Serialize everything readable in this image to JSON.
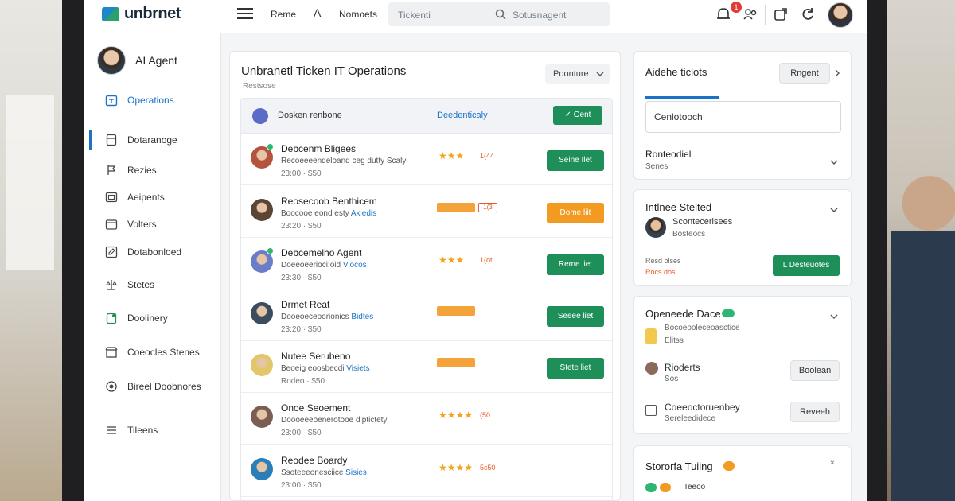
{
  "topbar": {
    "logo_text": "unbrnet",
    "nav_1": "Reme",
    "nav_2_icon": "A",
    "nav_3": "Nomoets",
    "search_placeholder": "Tickenti",
    "search_placeholder_2": "Sotusnagent",
    "notification_count": "1"
  },
  "sidebar": {
    "agent_name": "AI Agent",
    "items": [
      {
        "label": "Operations",
        "icon": "calendar-icon"
      },
      {
        "label": "Dotaranoge",
        "icon": "document-icon"
      },
      {
        "label": "Rezies",
        "icon": "flag-icon"
      },
      {
        "label": "Aeipents",
        "icon": "image-icon"
      },
      {
        "label": "Volters",
        "icon": "folder-icon"
      },
      {
        "label": "Dotabonloed",
        "icon": "edit-icon"
      },
      {
        "label": "Stetes",
        "icon": "scale-icon"
      },
      {
        "label": "Doolinery",
        "icon": "clipboard-icon"
      },
      {
        "label": "Coeocles Stenes",
        "icon": "store-icon"
      },
      {
        "label": "Bireel Doobnores",
        "icon": "circle-icon"
      },
      {
        "label": "Tileens",
        "icon": "list-icon"
      }
    ]
  },
  "main": {
    "title": "Unbranetl Ticken IT Operations",
    "subtitle": "Restsose",
    "dropdown_label": "Poonture",
    "header_row": {
      "name": "Dosken renbone",
      "link": "Deedenticaly",
      "button": "Oent"
    },
    "rows": [
      {
        "name": "Debcenm Bligees",
        "desc": "Recoeeeendeloand ceg dutty Scaly",
        "desc_link": "",
        "meta": "23:00  ·  $50",
        "stars": "★★★",
        "rating": "1(44",
        "button": "Seine Ilet",
        "style": "stars",
        "online": true,
        "avatar_color": "#b5543e"
      },
      {
        "name": "Reosecoob Benthicem",
        "desc": "Boocooe eond esty",
        "desc_link": "Akiedis",
        "meta": "23:20  ·  $50",
        "stars": "",
        "rating": "1(3",
        "button": "Dome liit",
        "style": "tag",
        "online": false,
        "avatar_color": "#5b4535"
      },
      {
        "name": "Debcemelho Agent",
        "desc": "Doeeoeerioci:oid",
        "desc_link": "Viocos",
        "meta": "23:30  ·  $50",
        "stars": "★★★",
        "rating": "1(ot",
        "button": "Reme liet",
        "style": "stars",
        "online": true,
        "avatar_color": "#6a7dc9"
      },
      {
        "name": "Drmet Reat",
        "desc": "Dooeoeceoorionics",
        "desc_link": "Bidtes",
        "meta": "23:20  ·  $50",
        "stars": "",
        "rating": "",
        "button": "Seeee liet",
        "style": "tag",
        "online": false,
        "avatar_color": "#3b4c5e"
      },
      {
        "name": "Nutee Serubeno",
        "desc": "Beoeig eoosbecdi",
        "desc_link": "Visiets",
        "meta": "Rodeo  ·  $50",
        "stars": "",
        "rating": "",
        "button": "Stete liet",
        "style": "tag",
        "online": false,
        "avatar_color": "#e2c76a"
      },
      {
        "name": "Onoe Seoement",
        "desc": "Doooeeeoenerotooe diptictety",
        "desc_link": "",
        "meta": "23:00  ·  $50",
        "stars": "★★★★",
        "rating": "(50",
        "button": "",
        "style": "stars",
        "online": false,
        "avatar_color": "#7a5e54"
      },
      {
        "name": "Reodee Boardy",
        "desc": "Ssoteeeonesciice",
        "desc_link": "Sisies",
        "meta": "23:00  ·  $50",
        "stars": "★★★★",
        "rating": "5c50",
        "button": "",
        "style": "stars",
        "online": false,
        "avatar_color": "#2a7fb8"
      }
    ]
  },
  "right": {
    "card1": {
      "title": "Aidehe ticlots",
      "button": "Rngent",
      "search_placeholder": "Cenlotooch",
      "item_title": "Ronteodiel",
      "item_sub": "Senes"
    },
    "card2": {
      "title": "Intlnee Stelted",
      "person_name": "Scontecerisees",
      "person_sub": "Bosteocs",
      "meta_1": "Resd  olses",
      "meta_2": "Rocs  dos",
      "button": "L Desteuotes"
    },
    "card3": {
      "title": "Openeede Dace",
      "line_1": "Bocoeooleceoasctice",
      "line_2": "Elitss",
      "person_name": "Rioderts",
      "person_sub": "Sos",
      "button_1": "Boolean",
      "item_2": "Coeeoctoruenbey",
      "item_2_sub": "Sereleedidece",
      "button_2": "Reveeh"
    },
    "card4": {
      "title": "Stororfa Tuiing",
      "value": "Teeoo"
    }
  },
  "colors": {
    "primary": "#1a73c7",
    "green": "#1f8f5a",
    "orange": "#f39a22",
    "star": "#f0a41a"
  }
}
